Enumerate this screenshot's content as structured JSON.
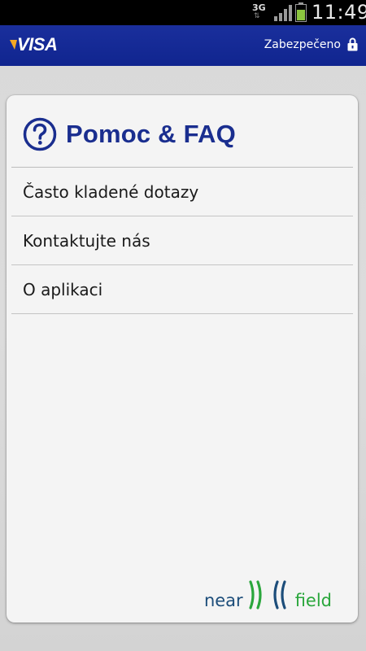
{
  "status_bar": {
    "network": "3G",
    "time": "11:49"
  },
  "app_bar": {
    "brand": "VISA",
    "secure_label": "Zabezpečeno",
    "icons": {
      "lock": "lock-icon"
    }
  },
  "header": {
    "title": "Pomoc & FAQ",
    "icon": "help-circle-icon"
  },
  "menu": {
    "items": [
      {
        "label": "Často kladené dotazy"
      },
      {
        "label": "Kontaktujte nás"
      },
      {
        "label": "O aplikaci"
      }
    ]
  },
  "footer": {
    "logo_left": "near",
    "logo_right": "field"
  },
  "colors": {
    "brand_blue": "#1a2e8f",
    "app_bar": "#12278f",
    "field_green": "#2aa63c",
    "near_blue": "#1c4d7a"
  }
}
